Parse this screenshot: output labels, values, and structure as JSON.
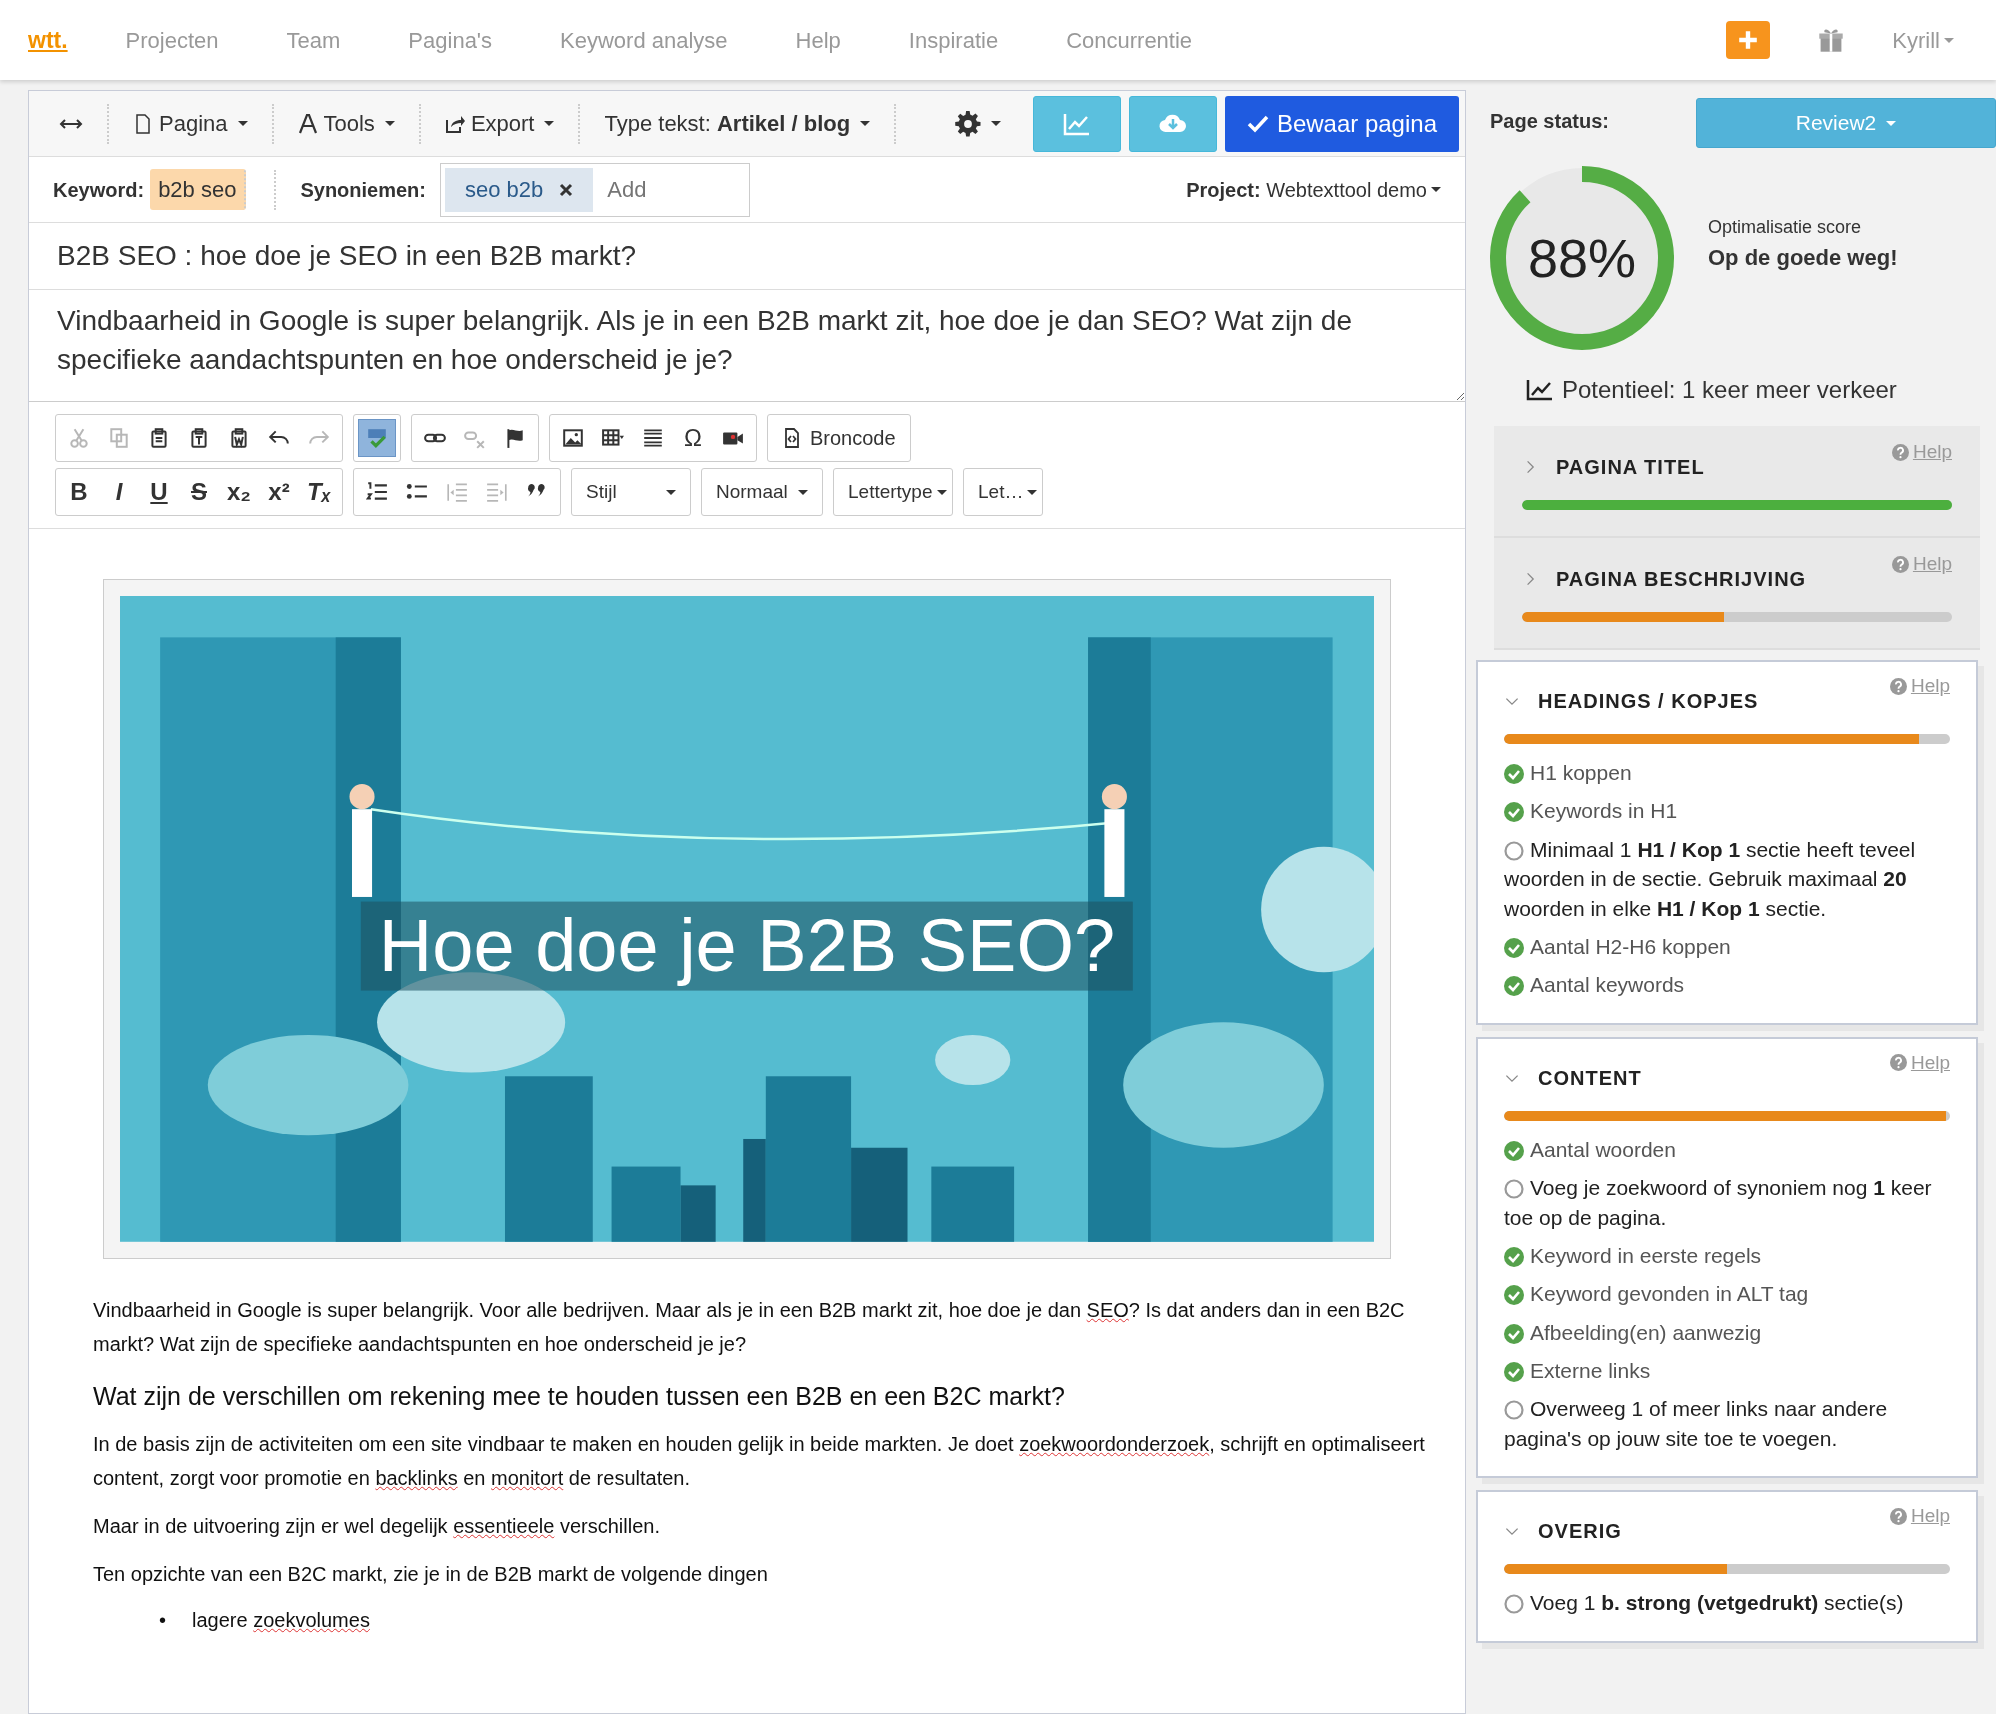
{
  "nav": {
    "brand": "wtt.",
    "items": [
      "Projecten",
      "Team",
      "Pagina's",
      "Keyword analyse",
      "Help",
      "Inspiratie",
      "Concurrentie"
    ],
    "user": "Kyrill"
  },
  "toolbar": {
    "page_menu": "Pagina",
    "tools_menu": "Tools",
    "export_menu": "Export",
    "text_type": "Type tekst: **Artikel / blog**",
    "save": "Bewaar pagina"
  },
  "keyword_row": {
    "keyword_label": "Keyword:",
    "keyword": "b2b seo",
    "synonyms_label": "Synoniemen:",
    "synonyms": [
      "seo b2b"
    ],
    "synonym_placeholder": "Add",
    "project_label": "Project:",
    "project": "Webtexttool demo"
  },
  "title_field": "B2B SEO : hoe doe je SEO in een B2B markt?",
  "description_field": "Vindbaarheid in Google is super belangrijk. Als je in een B2B markt zit, hoe doe je dan SEO? Wat zijn de specifieke aandachtspunten en hoe onderscheid je je?",
  "editor_toolbar": {
    "rows": [
      [
        [
          {
            "kind": "cut",
            "disabled": true
          },
          {
            "kind": "copy",
            "disabled": true
          },
          {
            "kind": "paste",
            "disabled": false
          },
          {
            "kind": "pastetext",
            "disabled": false
          },
          {
            "kind": "pasteword",
            "disabled": false
          },
          {
            "kind": "undo",
            "disabled": false
          },
          {
            "kind": "redo",
            "disabled": true
          }
        ],
        [
          {
            "kind": "spell",
            "disabled": false,
            "active": true
          }
        ],
        [
          {
            "kind": "link",
            "disabled": false
          },
          {
            "kind": "unlink",
            "disabled": true
          },
          {
            "kind": "flag",
            "disabled": false
          }
        ],
        [
          {
            "kind": "image",
            "disabled": false
          },
          {
            "kind": "table",
            "disabled": false
          },
          {
            "kind": "hr",
            "disabled": false
          },
          {
            "kind": "glyph",
            "label": "Ω",
            "disabled": false
          },
          {
            "kind": "video",
            "disabled": false
          }
        ],
        [
          {
            "kind": "source",
            "label": "Broncode",
            "disabled": false
          }
        ]
      ],
      [
        [
          {
            "kind": "bold",
            "label": "B",
            "disabled": false
          },
          {
            "kind": "italic",
            "label": "I",
            "disabled": false
          },
          {
            "kind": "underline",
            "label": "U",
            "disabled": false
          },
          {
            "kind": "strike",
            "label": "S",
            "disabled": false
          },
          {
            "kind": "bold",
            "label": "x₂",
            "disabled": false
          },
          {
            "kind": "bold",
            "label": "x²",
            "disabled": false
          },
          {
            "kind": "italic",
            "label": "Tₓ",
            "disabled": false
          }
        ],
        [
          {
            "kind": "ol",
            "disabled": false
          },
          {
            "kind": "ul",
            "disabled": false
          },
          {
            "kind": "outdent",
            "disabled": true
          },
          {
            "kind": "indent",
            "disabled": true
          },
          {
            "kind": "quote",
            "disabled": false
          }
        ]
      ]
    ],
    "dropdowns": [
      "Stijl",
      "Normaal",
      "Lettertype",
      "Let…"
    ]
  },
  "content": {
    "banner_text": "Hoe doe je B2B SEO?",
    "blocks": [
      {
        "kind": "p",
        "parts": [
          {
            "text": "Vindbaarheid in Google is super belangrijk. Voor alle bedrijven. Maar als je in een B2B markt zit, hoe doe je dan ",
            "misspelled": false
          },
          {
            "text": "SEO",
            "misspelled": true
          },
          {
            "text": "? Is dat anders dan in een B2C markt? Wat zijn de specifieke aandachtspunten en hoe onderscheid je je?",
            "misspelled": false
          }
        ]
      },
      {
        "kind": "h2",
        "parts": [
          {
            "text": "Wat zijn de verschillen om rekening mee te houden tussen een B2B en een B2C markt?",
            "misspelled": false
          }
        ]
      },
      {
        "kind": "p",
        "parts": [
          {
            "text": "In de basis zijn de activiteiten om een site vindbaar te maken en houden gelijk in beide markten. Je doet ",
            "misspelled": false
          },
          {
            "text": "zoekwoordonderzoek",
            "misspelled": true
          },
          {
            "text": ", schrijft en optimaliseert content, zorgt voor promotie en ",
            "misspelled": false
          },
          {
            "text": "backlinks",
            "misspelled": true
          },
          {
            "text": " en ",
            "misspelled": false
          },
          {
            "text": "monitort",
            "misspelled": true
          },
          {
            "text": " de resultaten.",
            "misspelled": false
          }
        ]
      },
      {
        "kind": "p",
        "parts": [
          {
            "text": "Maar in de uitvoering zijn er wel degelijk ",
            "misspelled": false
          },
          {
            "text": "essentieele",
            "misspelled": true
          },
          {
            "text": " verschillen.",
            "misspelled": false
          }
        ]
      },
      {
        "kind": "p",
        "parts": [
          {
            "text": "Ten opzichte van een B2C markt, zie je in de B2B markt de volgende dingen",
            "misspelled": false
          }
        ]
      },
      {
        "kind": "li",
        "bullet": "•",
        "parts": [
          {
            "text": "lagere ",
            "misspelled": false
          },
          {
            "text": "zoekvolumes",
            "misspelled": true
          }
        ]
      }
    ]
  },
  "sidebar": {
    "status_label": "Page status:",
    "status": "Review2",
    "score": {
      "value": "88%",
      "level": 0.88,
      "label": "Optimalisatie score",
      "verdict": "Op de goede weg!"
    },
    "potential": "Potentieel: 1 keer meer verkeer",
    "sections": [
      {
        "title": "PAGINA TITEL",
        "help": "Help",
        "expanded": false,
        "level": 1.0,
        "color": "#4caf3e"
      },
      {
        "title": "PAGINA BESCHRIJVING",
        "help": "Help",
        "expanded": false,
        "level": 0.47,
        "color": "#e8891b"
      },
      {
        "title": "HEADINGS / KOPJES",
        "help": "Help",
        "expanded": true,
        "level": 0.93,
        "color": "#e8891b",
        "items": [
          {
            "text": "H1 koppen",
            "ok": true
          },
          {
            "text": "Keywords in H1",
            "ok": true
          },
          {
            "text": "Minimaal 1 **H1 / Kop 1** sectie heeft teveel woorden in de sectie. Gebruik maximaal **20** woorden in elke **H1 / Kop 1** sectie.",
            "ok": false
          },
          {
            "text": "Aantal H2-H6 koppen",
            "ok": true
          },
          {
            "text": "Aantal keywords",
            "ok": true
          }
        ]
      },
      {
        "title": "CONTENT",
        "help": "Help",
        "expanded": true,
        "level": 0.99,
        "color": "#e8891b",
        "items": [
          {
            "text": "Aantal woorden",
            "ok": true
          },
          {
            "text": "Voeg je zoekwoord of synoniem nog **1** keer toe op de pagina.",
            "ok": false
          },
          {
            "text": "Keyword in eerste regels",
            "ok": true
          },
          {
            "text": "Keyword gevonden in ALT tag",
            "ok": true
          },
          {
            "text": "Afbeelding(en) aanwezig",
            "ok": true
          },
          {
            "text": "Externe links",
            "ok": true
          },
          {
            "text": "Overweeg 1 of meer links naar andere pagina's op jouw site toe te voegen.",
            "ok": false
          }
        ]
      },
      {
        "title": "OVERIG",
        "help": "Help",
        "expanded": true,
        "level": 0.5,
        "color": "#e8891b",
        "items": [
          {
            "text": "Voeg 1 **b. strong (vetgedrukt)** sectie(s)",
            "ok": false
          }
        ]
      }
    ]
  }
}
